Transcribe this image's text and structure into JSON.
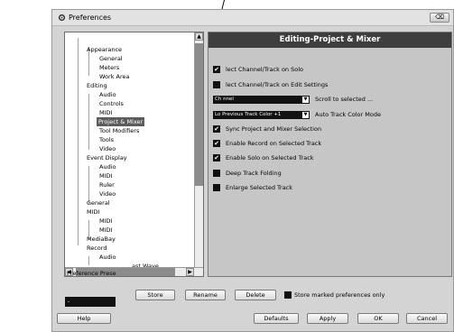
{
  "window": {
    "title": "Preferences",
    "close_label": "⌫"
  },
  "tree": {
    "items": [
      {
        "label": "Appearance"
      },
      {
        "label": "General"
      },
      {
        "label": "Meters"
      },
      {
        "label": "Work Area"
      },
      {
        "label": "Editing"
      },
      {
        "label": "Audio"
      },
      {
        "label": "Controls"
      },
      {
        "label": "MIDI"
      },
      {
        "label": "Project & Mixer",
        "selected": true
      },
      {
        "label": "Tool Modifiers"
      },
      {
        "label": "Tools"
      },
      {
        "label": "Video"
      },
      {
        "label": "Event Display"
      },
      {
        "label": "Audio"
      },
      {
        "label": "MIDI"
      },
      {
        "label": "Ruler"
      },
      {
        "label": "Video"
      },
      {
        "label": "General"
      },
      {
        "label": "MIDI"
      },
      {
        "label": "MIDI"
      },
      {
        "label": "MIDI"
      },
      {
        "label": "MediaBay"
      },
      {
        "label": "Record"
      },
      {
        "label": "Audio"
      },
      {
        "label": "ast Wave"
      }
    ]
  },
  "panel": {
    "header": "Editing-Project & Mixer",
    "options": [
      {
        "label": "lect Channel/Track on Solo",
        "checked": true
      },
      {
        "label": "lect Channel/Track on Edit Settings",
        "checked": false
      },
      {
        "label": "Sync Project and Mixer Selection",
        "checked": true
      },
      {
        "label": "Enable Record on Selected Track",
        "checked": true
      },
      {
        "label": "Enable Solo on Selected Track",
        "checked": true
      },
      {
        "label": "Deep Track Folding",
        "checked": false
      },
      {
        "label": "Enlarge Selected Track",
        "checked": false
      }
    ],
    "combo_scroll": {
      "value": "Ch nnel",
      "label": "Scroll to selected ..."
    },
    "combo_color": {
      "value": "Lo Previous Track Color +1",
      "label": "Auto Track Color Mode"
    }
  },
  "presets": {
    "label": "Preference Prese",
    "field_value": "-",
    "store_label": "Store",
    "rename_label": "Rename",
    "delete_label": "Delete",
    "store_marked_label": "Store marked preferences only"
  },
  "footer": {
    "help_label": "Help",
    "defaults_label": "Defaults",
    "apply_label": "Apply",
    "ok_label": "OK",
    "cancel_label": "Cancel"
  },
  "icons": {
    "title_icon": "gear-icon",
    "check": "✔",
    "arrow_down": "▼",
    "arrow_up": "▲",
    "arrow_left": "◀",
    "arrow_right": "▶"
  }
}
